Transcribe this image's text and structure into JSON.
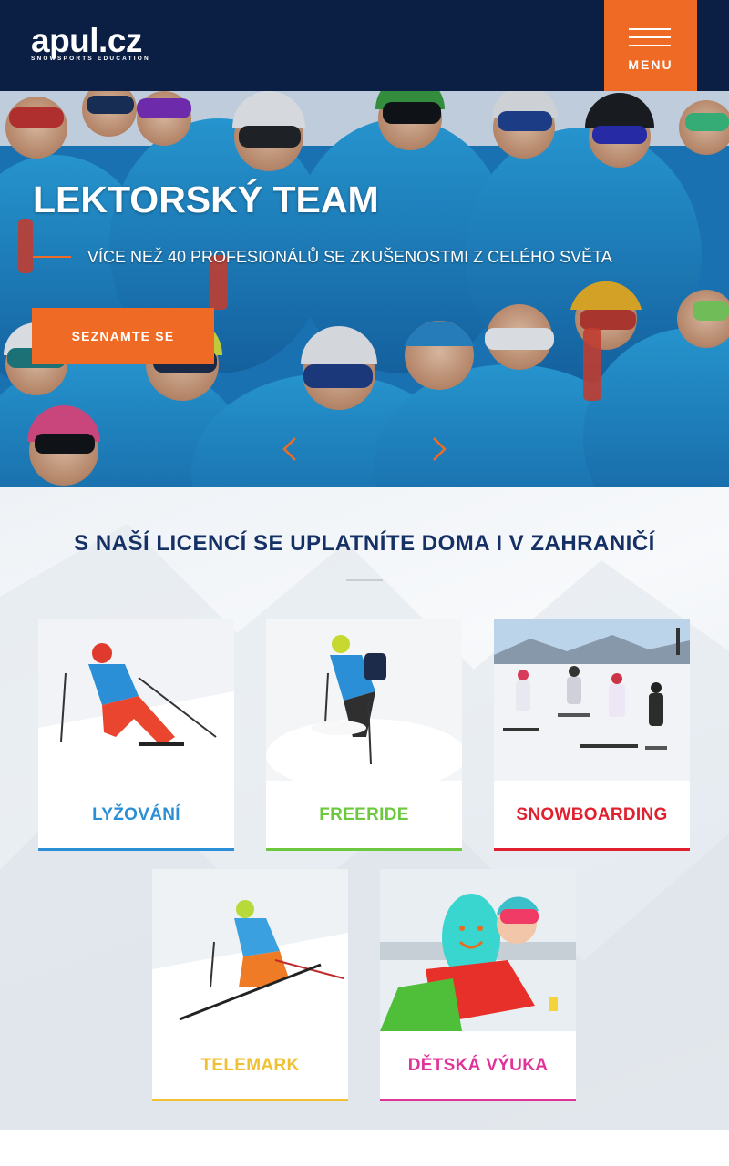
{
  "header": {
    "logo_text": "apul.cz",
    "logo_tagline": "SNOWSPORTS EDUCATION",
    "menu_label": "MENU",
    "colors": {
      "background": "#0b1f45",
      "menu_button": "#ef6b25"
    }
  },
  "hero": {
    "title": "LEKTORSKÝ TEAM",
    "subtitle": "VÍCE NEŽ 40 PROFESIONÁLŮ SE ZKUŠENOSTMI Z CELÉHO SVĚTA",
    "cta_label": "SEZNAMTE SE",
    "prev_icon": "chevron-left-icon",
    "next_icon": "chevron-right-icon",
    "accent_color": "#ef6b25"
  },
  "section": {
    "title": "S NAŠÍ LICENCÍ SE UPLATNÍTE DOMA I V ZAHRANIČÍ",
    "title_color": "#153064",
    "cards": [
      {
        "label": "LYŽOVÁNÍ",
        "color": "#2a8fd6"
      },
      {
        "label": "FREERIDE",
        "color": "#6cc93f"
      },
      {
        "label": "SNOWBOARDING",
        "color": "#e0202e"
      },
      {
        "label": "TELEMARK",
        "color": "#f0c033"
      },
      {
        "label": "DĚTSKÁ VÝUKA",
        "color": "#e0339a"
      }
    ]
  }
}
